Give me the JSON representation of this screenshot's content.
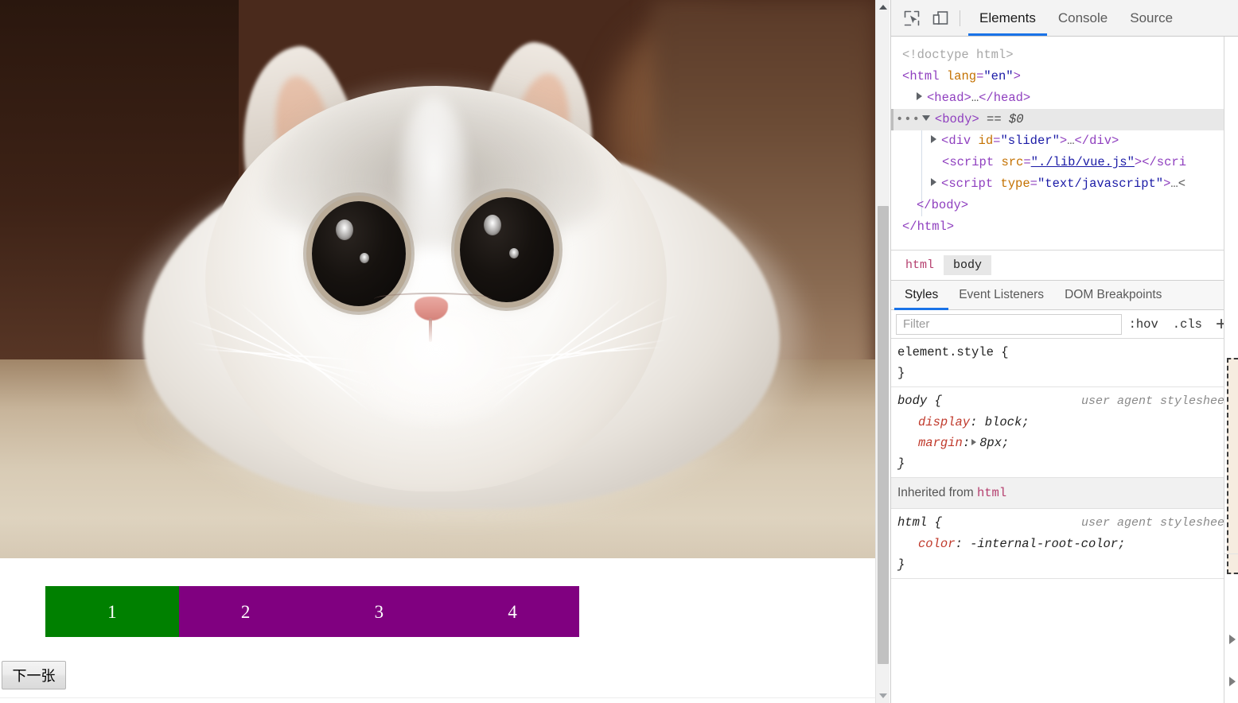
{
  "page": {
    "photo": {
      "alt": "white fluffy kitten lying on a rug"
    },
    "slider": {
      "segments": [
        {
          "label": "1",
          "state": "active"
        },
        {
          "label": "2",
          "state": "inactive"
        },
        {
          "label": "3",
          "state": "inactive"
        },
        {
          "label": "4",
          "state": "inactive"
        }
      ],
      "active_color": "#008000",
      "inactive_color": "#800080",
      "text_color": "#ffffff"
    },
    "next_button": {
      "label": "下一张"
    },
    "scrollbar": {
      "up_arrow": "scroll-up-arrow",
      "down_arrow": "scroll-down-arrow"
    }
  },
  "devtools": {
    "toolbar": {
      "inspect_icon": "inspect-element-icon",
      "device_icon": "device-toolbar-icon",
      "tabs": [
        {
          "label": "Elements",
          "active": true
        },
        {
          "label": "Console",
          "active": false
        },
        {
          "label": "Source",
          "active": false
        }
      ]
    },
    "dom": {
      "lines": [
        {
          "text": "<!doctype html>"
        },
        {
          "open": "<",
          "tag": "html",
          "attr": "lang",
          "eq": "=",
          "val": "\"en\"",
          "close": ">"
        },
        {
          "tag_open": "<head>",
          "ellipsis": "…",
          "tag_close": "</head>"
        },
        {
          "tag_open": "<body>",
          "suffix": "== $0"
        },
        {
          "open": "<",
          "tag": "div",
          "attr": "id",
          "eq": "=",
          "val": "\"slider\"",
          "close": ">",
          "ellipsis": "…",
          "tag_close": "</div>"
        },
        {
          "open": "<",
          "tag": "script",
          "attr": "src",
          "eq": "=",
          "val": "\"./lib/vue.js\"",
          "close": ">",
          "tag_close": "</scri"
        },
        {
          "open": "<",
          "tag": "script",
          "attr": "type",
          "eq": "=",
          "val": "\"text/javascript\"",
          "close": ">",
          "ellipsis": "…<"
        },
        {
          "tag_close": "</body>"
        },
        {
          "tag_close": "</html>"
        }
      ]
    },
    "breadcrumb": [
      {
        "label": "html",
        "active": false
      },
      {
        "label": "body",
        "active": true
      }
    ],
    "subtabs": [
      {
        "label": "Styles",
        "active": true
      },
      {
        "label": "Event Listeners",
        "active": false
      },
      {
        "label": "DOM Breakpoints",
        "active": false
      }
    ],
    "filter": {
      "placeholder": "Filter",
      "value": "",
      "hov_label": ":hov",
      "cls_label": ".cls",
      "new_rule_label": "+"
    },
    "rules": [
      {
        "selector": "element.style {",
        "origin": "",
        "declarations": [],
        "closing": "}"
      },
      {
        "selector": "body {",
        "origin": "user agent stylesheet",
        "declarations": [
          {
            "prop": "display",
            "value": "block;",
            "expandable": false
          },
          {
            "prop": "margin",
            "value": "8px;",
            "expandable": true
          }
        ],
        "closing": "}"
      }
    ],
    "inherited": {
      "label": "Inherited from",
      "source": "html"
    },
    "inherited_rules": [
      {
        "selector": "html {",
        "origin": "user agent stylesheet",
        "declarations": [
          {
            "prop": "color",
            "value": "-internal-root-color;",
            "expandable": false
          }
        ],
        "closing": "}"
      }
    ]
  }
}
